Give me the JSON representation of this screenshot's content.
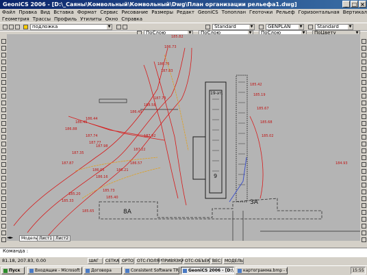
{
  "title": "GeoniCS 2006 - [D:\\_Саяны\\Комвольный\\Комвольный\\Dwg\\План организации рельефа1.dwg]",
  "menu_row1": [
    "Файл",
    "Правка",
    "Вид",
    "Вставка",
    "Формат",
    "Сервис",
    "Рисование",
    "Размеры",
    "Редакт",
    "GeoniCS",
    "Топоплан",
    "Геоточки",
    "Рельеф",
    "Горизонтальная",
    "Вертикальная",
    "Благоустройство",
    "Сети"
  ],
  "menu_row2": [
    "Геометрия",
    "Трассы",
    "Профиль",
    "Утилиты",
    "Окно",
    "Справка"
  ],
  "toolbar": {
    "layer_name": "подложка",
    "text_style": "Standard",
    "dim_style": "GENPLAN",
    "table_style": "Standard",
    "color": "ПоСлою",
    "linetype": "ПоСлою",
    "lineweight": "ПоСлою",
    "plot_style": "ПоЦвету"
  },
  "tabs": [
    "Модель",
    "Лист1",
    "Лист2"
  ],
  "command": {
    "prompt": "Команда :"
  },
  "status": {
    "coords": "81.18, 207.83, 0.00",
    "buttons": [
      "ШАГ",
      "СЕТКА",
      "ОРТО",
      "ОТС-ПОЛЯР",
      "ПРИВЯЗКА",
      "ОТС-ОБЪЕКТ",
      "ВЕС",
      "МОДЕЛЬ"
    ]
  },
  "taskbar": {
    "start": "Пуск",
    "tasks": [
      "Входящие - Microsoft O...",
      "Договора",
      "Consistent Software TR...",
      "GeoniCS 2006 - [D:\\_...",
      "картограмма.bmp - Paint"
    ],
    "time": "15:55"
  },
  "drawing": {
    "building_labels": [
      "8А",
      "3А"
    ],
    "plan_labels": [
      "9",
      "19-эт."
    ],
    "elevation_labels": [
      "185.33",
      "185.20",
      "185.65",
      "185.73",
      "185.40",
      "186.05",
      "186.16",
      "186.21",
      "186.57",
      "187.22",
      "187.92",
      "187.74",
      "187.77",
      "187.98",
      "187.35",
      "187.87",
      "186.88",
      "186.45",
      "186.44",
      "186.45",
      "188.58",
      "187.73",
      "187.83",
      "186.75",
      "186.73",
      "185.82",
      "185.42",
      "185.19",
      "185.67",
      "185.68",
      "185.02",
      "184.93"
    ]
  },
  "colors": {
    "canvas": "#b4b4b4",
    "title_bar": "#0a246a",
    "contour_red": "#d81818",
    "contour_orange": "#e0a020",
    "accent_blue": "#3c50c8"
  }
}
